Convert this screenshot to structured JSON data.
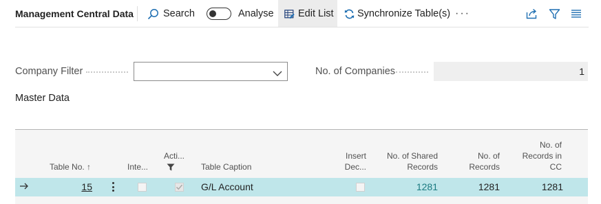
{
  "page": {
    "title": "Management Central Data"
  },
  "toolbar": {
    "search_label": "Search",
    "analyse_label": "Analyse",
    "analyse_on": false,
    "edit_list_label": "Edit List",
    "sync_label": "Synchronize Table(s)",
    "more_label": "···"
  },
  "filters": {
    "company_filter_label": "Company Filter",
    "company_filter_value": "",
    "companies_label": "No. of Companies",
    "companies_value": "1"
  },
  "section": {
    "title": "Master Data"
  },
  "table": {
    "headers": {
      "table_no": "Table No. ↑",
      "inte": "Inte...",
      "acti": "Acti...",
      "caption": "Table Caption",
      "insert_line1": "Insert",
      "insert_line2": "Dec...",
      "shared_line1": "No. of Shared",
      "shared_line2": "Records",
      "records_line1": "No. of",
      "records_line2": "Records",
      "cc_line1": "No. of",
      "cc_line2": "Records in",
      "cc_line3": "CC"
    },
    "rows": [
      {
        "table_no": "15",
        "inte": false,
        "acti": true,
        "caption": "G/L Account",
        "insert_dec": false,
        "shared_records": "1281",
        "records": "1281",
        "records_in_cc": "1281"
      }
    ]
  },
  "colors": {
    "accent": "#1a7a80",
    "row_selected": "#bfe6ea",
    "edit_list_bg": "#ececec"
  },
  "icons": {
    "search": "search-icon",
    "edit_list": "edit-list-icon",
    "sync": "sync-icon",
    "share": "share-icon",
    "filter": "filter-icon",
    "list": "list-icon",
    "row_arrow": "arrow-right-icon",
    "row_menu": "more-vertical-icon",
    "column_filter": "filter-icon"
  }
}
